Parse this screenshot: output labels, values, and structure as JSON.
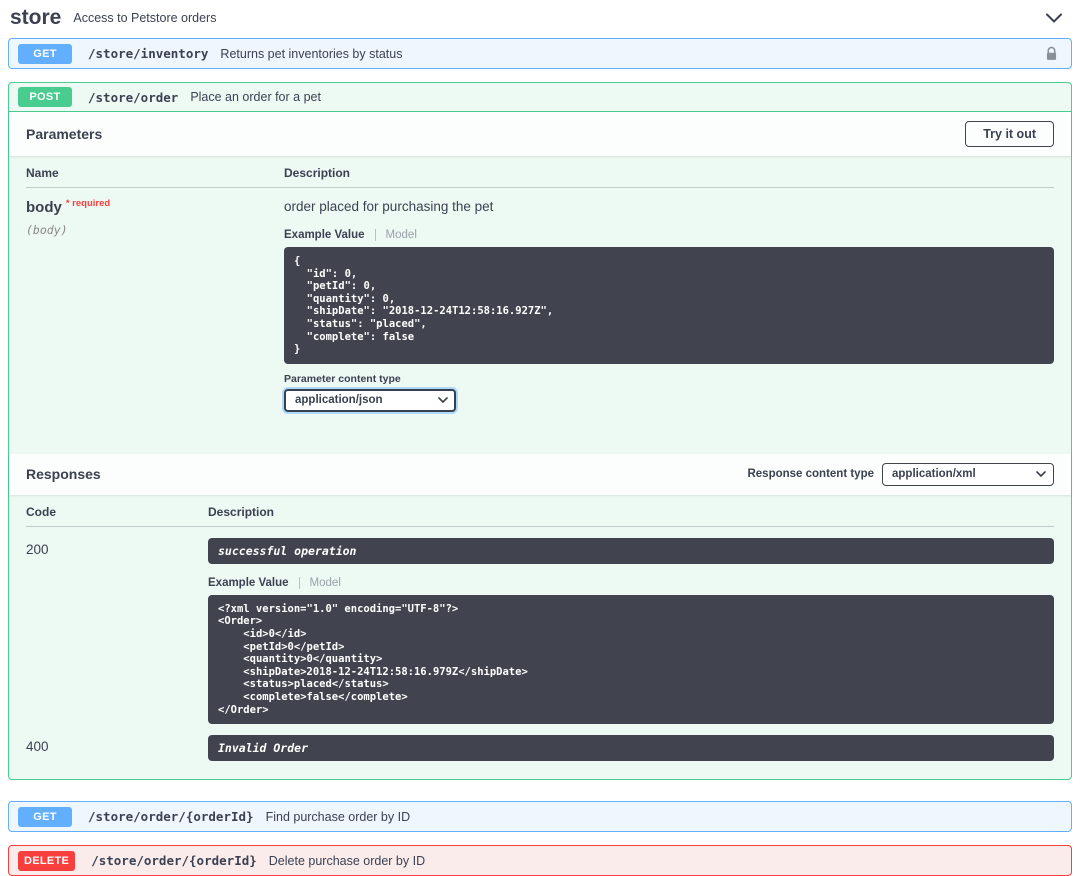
{
  "section": {
    "title": "store",
    "subtitle": "Access to Petstore orders"
  },
  "ops": {
    "inventory": {
      "method": "GET",
      "path": "/store/inventory",
      "summary": "Returns pet inventories by status"
    },
    "order_post": {
      "method": "POST",
      "path": "/store/order",
      "summary": "Place an order for a pet"
    },
    "order_get": {
      "method": "GET",
      "path": "/store/order/{orderId}",
      "summary": "Find purchase order by ID"
    },
    "order_delete": {
      "method": "DELETE",
      "path": "/store/order/{orderId}",
      "summary": "Delete purchase order by ID"
    }
  },
  "parameters": {
    "heading": "Parameters",
    "try_it_out": "Try it out",
    "col_name": "Name",
    "col_description": "Description",
    "body_param": {
      "name": "body",
      "required": "* required",
      "location": "(body)",
      "description": "order placed for purchasing the pet"
    },
    "tabs": {
      "example": "Example Value",
      "model": "Model"
    },
    "example_json": "{\n  \"id\": 0,\n  \"petId\": 0,\n  \"quantity\": 0,\n  \"shipDate\": \"2018-12-24T12:58:16.927Z\",\n  \"status\": \"placed\",\n  \"complete\": false\n}",
    "content_type_label": "Parameter content type",
    "content_type_value": "application/json"
  },
  "responses": {
    "heading": "Responses",
    "content_type_label": "Response content type",
    "content_type_value": "application/xml",
    "col_code": "Code",
    "col_description": "Description",
    "r200": {
      "code": "200",
      "description": "successful operation",
      "tabs": {
        "example": "Example Value",
        "model": "Model"
      },
      "example_xml": "<?xml version=\"1.0\" encoding=\"UTF-8\"?>\n<Order>\n\t<id>0</id>\n\t<petId>0</petId>\n\t<quantity>0</quantity>\n\t<shipDate>2018-12-24T12:58:16.979Z</shipDate>\n\t<status>placed</status>\n\t<complete>false</complete>\n</Order>"
    },
    "r400": {
      "code": "400",
      "description": "Invalid Order"
    }
  },
  "colors": {
    "get": "#61affe",
    "post": "#49cc90",
    "delete": "#f93e3e",
    "code_background": "#41444e"
  }
}
